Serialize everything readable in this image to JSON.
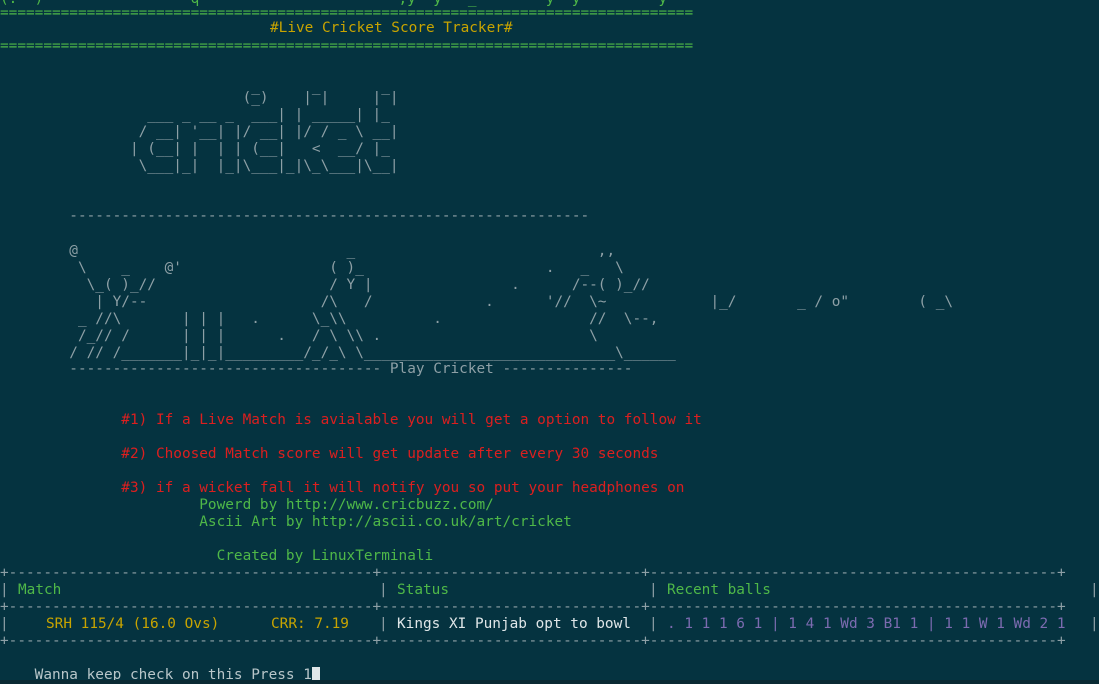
{
  "header": {
    "top_partial": "(.  )                 q                       ,y  y   _        y  y         y",
    "rule": "================================================================================",
    "title": "#Live Cricket Score Tracker#"
  },
  "logo_ascii": [
    "                             _      _       _",
    "                            (_)    | |     | |",
    "                 ___ _ __ _  ___| | _____| |_",
    "                / __| '__| |/ __| |/ / _ \\ __|",
    "               | (__| |  | | (__|   <  __/ |_",
    "                \\___|_|  |_|\\___|_|\\_\\___|\\__|"
  ],
  "art_divider_top": "        ------------------------------------------------------------",
  "cricket_ascii": [
    "        @                               _                            ,,",
    "         \\    _    @'                 ( )_                     .   _   \\",
    "          \\_( )_//                    / Y |                .      /--( )_//",
    "           | Y/--                    /\\   /             .      '//  \\~            |_/       _ / o\"        ( _\\",
    "         _ //\\       | | |   .      \\_\\\\          .                 //  \\--,",
    "         /_// /      | | |      .   / \\ \\\\ .                        \\",
    "        / // /_______|_|_|_________/_/_\\ \\_____________________________\\______"
  ],
  "art_divider_bottom": "        ------------------------------------ Play Cricket ---------------",
  "notes": [
    "              #1) If a Live Match is avialable you will get a option to follow it",
    "              #2) Choosed Match score will get update after every 30 seconds",
    "              #3) if a wicket fall it will notify you so put your headphones on"
  ],
  "credits": [
    "                       Powerd by http://www.cricbuzz.com/",
    "                       Ascii Art by http://ascii.co.uk/art/cricket",
    "                         Created by LinuxTerminali"
  ],
  "table": {
    "border": "+------------------------------------------+------------------------------+-----------------------------------------------+",
    "headers": [
      "Match",
      "Status",
      "Recent balls"
    ],
    "row": {
      "match": "SRH 115/4 (16.0 Ovs)",
      "crr": "CRR: 7.19",
      "status": "Kings XI Punjab opt to bowl",
      "recent_balls": ". 1 1 1 6 1 | 1 4 1 Wd 3 B1 1 | 1 1 W 1 Wd 2 1"
    }
  },
  "prompt": {
    "text": "Wanna keep check on this Press 1"
  },
  "colors": {
    "background": "#053340",
    "green": "#4fb848",
    "red": "#dc1f1f",
    "yellow": "#c8a400",
    "purple": "#7c6bb0",
    "gray": "#8ea0a6"
  }
}
